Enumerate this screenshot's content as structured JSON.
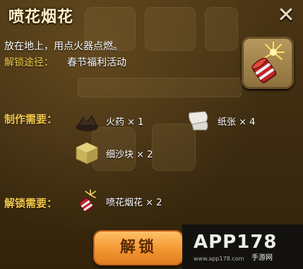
{
  "dialog": {
    "title": "喷花烟花",
    "description": "放在地上，用点火器点燃。",
    "unlock_path_label": "解锁途径：",
    "unlock_path_value": "春节福利活动",
    "close_glyph": "✕"
  },
  "craft": {
    "label": "制作需要：",
    "materials": [
      {
        "name": "火药 × 1",
        "icon": "gunpowder-icon"
      },
      {
        "name": "纸张 × 4",
        "icon": "paper-icon"
      },
      {
        "name": "细沙块 × 2",
        "icon": "sand-block-icon"
      }
    ]
  },
  "unlock_need": {
    "label": "解锁需要：",
    "item": {
      "name": "喷花烟花 × 2",
      "icon": "firework-icon"
    }
  },
  "button": {
    "label": "解锁"
  },
  "watermark": {
    "logo": "APP178",
    "sub": "手游网",
    "url": "www.app178.com"
  },
  "colors": {
    "accent": "#f6c94a",
    "button": "#f39a35",
    "background": "#3b2a10"
  }
}
